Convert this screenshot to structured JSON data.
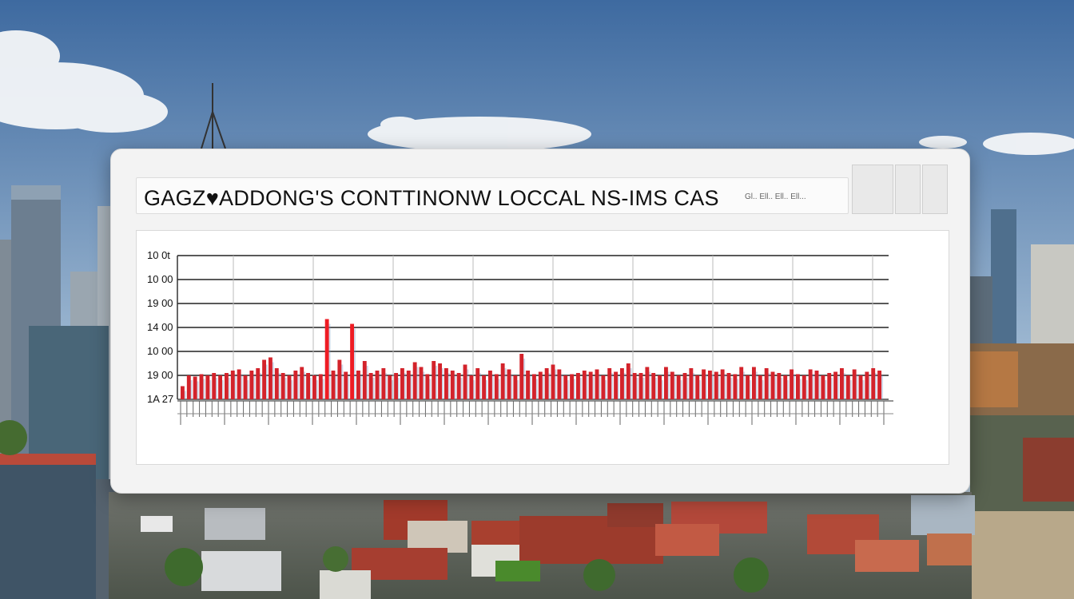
{
  "title": "GAGZ♥ADDONG'S CONTTINONW LOCCAL NS-IMS CAS",
  "title_tail": "Gl.. Ell.. Ell.. Ell...",
  "colors": {
    "bar": "#d3232b",
    "bar_highlight": "#ee1c24",
    "bar_shadow": "#7b95c4",
    "grid": "#222222",
    "sky_top": "#3e6aa0",
    "sky_bottom": "#b9cde0"
  },
  "chart_data": {
    "type": "bar",
    "title": "GAGZ♥ADDONG'S CONTTINONW LOCCAL NS-IMS CAS",
    "xlabel": "",
    "ylabel": "",
    "yticks": [
      "10 0t",
      "10 00",
      "19 00",
      "14 00",
      "10 00",
      "19 00",
      "1A 27"
    ],
    "ylim": [
      0,
      6
    ],
    "grid": true,
    "legend": "none",
    "values": [
      0.55,
      1.0,
      0.95,
      1.05,
      1.0,
      1.1,
      1.0,
      1.1,
      1.2,
      1.25,
      1.0,
      1.2,
      1.3,
      1.65,
      1.75,
      1.3,
      1.1,
      1.0,
      1.2,
      1.35,
      1.1,
      1.0,
      1.05,
      3.35,
      1.2,
      1.65,
      1.15,
      3.15,
      1.2,
      1.6,
      1.1,
      1.2,
      1.3,
      1.0,
      1.1,
      1.3,
      1.2,
      1.55,
      1.35,
      1.05,
      1.6,
      1.5,
      1.3,
      1.2,
      1.1,
      1.45,
      1.0,
      1.3,
      1.0,
      1.2,
      1.05,
      1.5,
      1.25,
      1.0,
      1.9,
      1.2,
      1.05,
      1.15,
      1.3,
      1.45,
      1.25,
      1.0,
      1.05,
      1.1,
      1.2,
      1.15,
      1.25,
      1.0,
      1.3,
      1.15,
      1.3,
      1.5,
      1.1,
      1.1,
      1.35,
      1.1,
      1.0,
      1.35,
      1.15,
      1.0,
      1.1,
      1.3,
      1.0,
      1.25,
      1.2,
      1.15,
      1.25,
      1.1,
      1.05,
      1.35,
      1.0,
      1.35,
      1.0,
      1.3,
      1.15,
      1.1,
      1.0,
      1.25,
      1.05,
      1.0,
      1.25,
      1.2,
      1.0,
      1.1,
      1.15,
      1.3,
      1.0,
      1.25,
      1.0,
      1.15,
      1.3,
      1.2
    ]
  }
}
